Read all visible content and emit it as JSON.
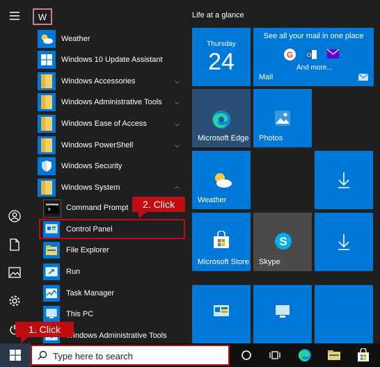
{
  "letter_header": "W",
  "apps": [
    {
      "label": "Weather",
      "expandable": false
    },
    {
      "label": "Windows 10 Update Assistant",
      "expandable": false
    },
    {
      "label": "Windows Accessories",
      "expandable": true
    },
    {
      "label": "Windows Administrative Tools",
      "expandable": true
    },
    {
      "label": "Windows Ease of Access",
      "expandable": true
    },
    {
      "label": "Windows PowerShell",
      "expandable": true
    },
    {
      "label": "Windows Security",
      "expandable": false
    },
    {
      "label": "Windows System",
      "expandable": true,
      "expanded": true
    }
  ],
  "system_items": [
    {
      "label": "Command Prompt"
    },
    {
      "label": "Control Panel"
    },
    {
      "label": "File Explorer"
    },
    {
      "label": "Run"
    },
    {
      "label": "Task Manager"
    },
    {
      "label": "This PC"
    },
    {
      "label": "Windows Administrative Tools"
    }
  ],
  "tiles": {
    "group_title": "Life at a glance",
    "calendar": {
      "day": "Thursday",
      "date": "24"
    },
    "mail": {
      "header": "See all your mail in one place",
      "more": "And more...",
      "label": "Mail"
    },
    "edge": {
      "label": "Microsoft Edge"
    },
    "photos": {
      "label": "Photos"
    },
    "weather": {
      "label": "Weather"
    },
    "store": {
      "label": "Microsoft Store"
    },
    "skype": {
      "label": "Skype"
    }
  },
  "annotations": {
    "step1": "1. Click",
    "step2": "2. Click"
  },
  "taskbar": {
    "search_placeholder": "Type here to search"
  },
  "colors": {
    "accent": "#0078d7",
    "annotation": "#c00d12",
    "background": "#1f1f1f"
  }
}
